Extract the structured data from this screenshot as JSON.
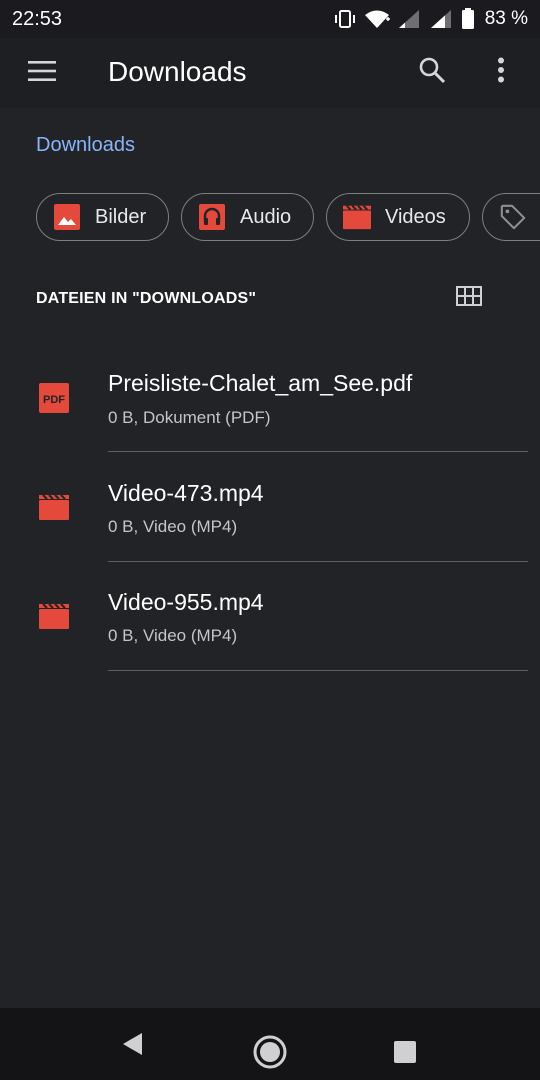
{
  "status_bar": {
    "time": "22:53",
    "battery": "83 %",
    "icons": [
      "vibrate-icon",
      "wifi-icon",
      "signal-icon",
      "signal-icon",
      "battery-icon"
    ]
  },
  "app_bar": {
    "title": "Downloads",
    "menu_icon": "hamburger-menu-icon",
    "search_icon": "search-icon",
    "more_icon": "more-vert-icon"
  },
  "breadcrumb": "Downloads",
  "chips": [
    {
      "label": "Bilder",
      "icon": "image-icon"
    },
    {
      "label": "Audio",
      "icon": "headphones-icon"
    },
    {
      "label": "Videos",
      "icon": "movie-icon"
    },
    {
      "label": "",
      "icon": "tag-icon"
    }
  ],
  "section": {
    "title": "DATEIEN IN \"DOWNLOADS\"",
    "view_toggle_icon": "grid-view-icon"
  },
  "files": [
    {
      "name": "Preisliste-Chalet_am_See.pdf",
      "meta": "0 B, Dokument (PDF)",
      "icon": "pdf-icon",
      "icon_text": "PDF"
    },
    {
      "name": "Video-473.mp4",
      "meta": "0 B, Video (MP4)",
      "icon": "movie-icon"
    },
    {
      "name": "Video-955.mp4",
      "meta": "0 B, Video (MP4)",
      "icon": "movie-icon"
    }
  ],
  "colors": {
    "background": "#222327",
    "accent_link": "#8ab4f8",
    "icon_red": "#e5493b"
  }
}
